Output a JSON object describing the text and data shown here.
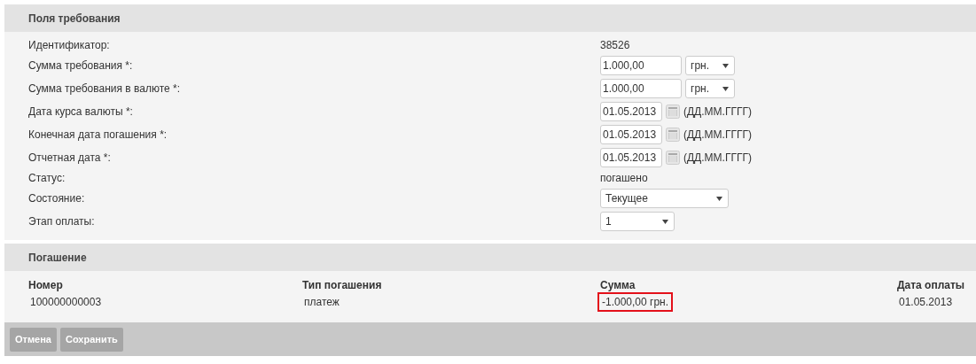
{
  "fields_section": {
    "title": "Поля требования",
    "fields": [
      {
        "kind": "text",
        "label": "Идентификатор:",
        "value": "38526"
      },
      {
        "kind": "amount",
        "label": "Сумма требования *:",
        "value": "1.000,00",
        "currency": "грн."
      },
      {
        "kind": "amount",
        "label": "Сумма требования в валюте *:",
        "value": "1.000,00",
        "currency": "грн."
      },
      {
        "kind": "date",
        "label": "Дата курса валюты *:",
        "value": "01.05.2013",
        "hint": "(ДД.ММ.ГГГГ)"
      },
      {
        "kind": "date",
        "label": "Конечная дата погашения *:",
        "value": "01.05.2013",
        "hint": "(ДД.ММ.ГГГГ)"
      },
      {
        "kind": "date",
        "label": "Отчетная дата *:",
        "value": "01.05.2013",
        "hint": "(ДД.ММ.ГГГГ)"
      },
      {
        "kind": "text",
        "label": "Статус:",
        "value": "погашено"
      },
      {
        "kind": "combo",
        "label": "Состояние:",
        "value": "Текущее"
      },
      {
        "kind": "select",
        "label": "Этап оплаты:",
        "value": "1"
      }
    ]
  },
  "repayment_section": {
    "title": "Погашение",
    "columns": [
      "Номер",
      "Тип погашения",
      "Сумма",
      "Дата оплаты"
    ],
    "rows": [
      {
        "cells": [
          {
            "text": "100000000003",
            "highlighted": false
          },
          {
            "text": "платеж",
            "highlighted": false
          },
          {
            "text": "-1.000,00 грн.",
            "highlighted": true
          },
          {
            "text": "01.05.2013",
            "highlighted": false
          }
        ]
      }
    ]
  },
  "buttons": [
    "Отмена",
    "Сохранить"
  ]
}
